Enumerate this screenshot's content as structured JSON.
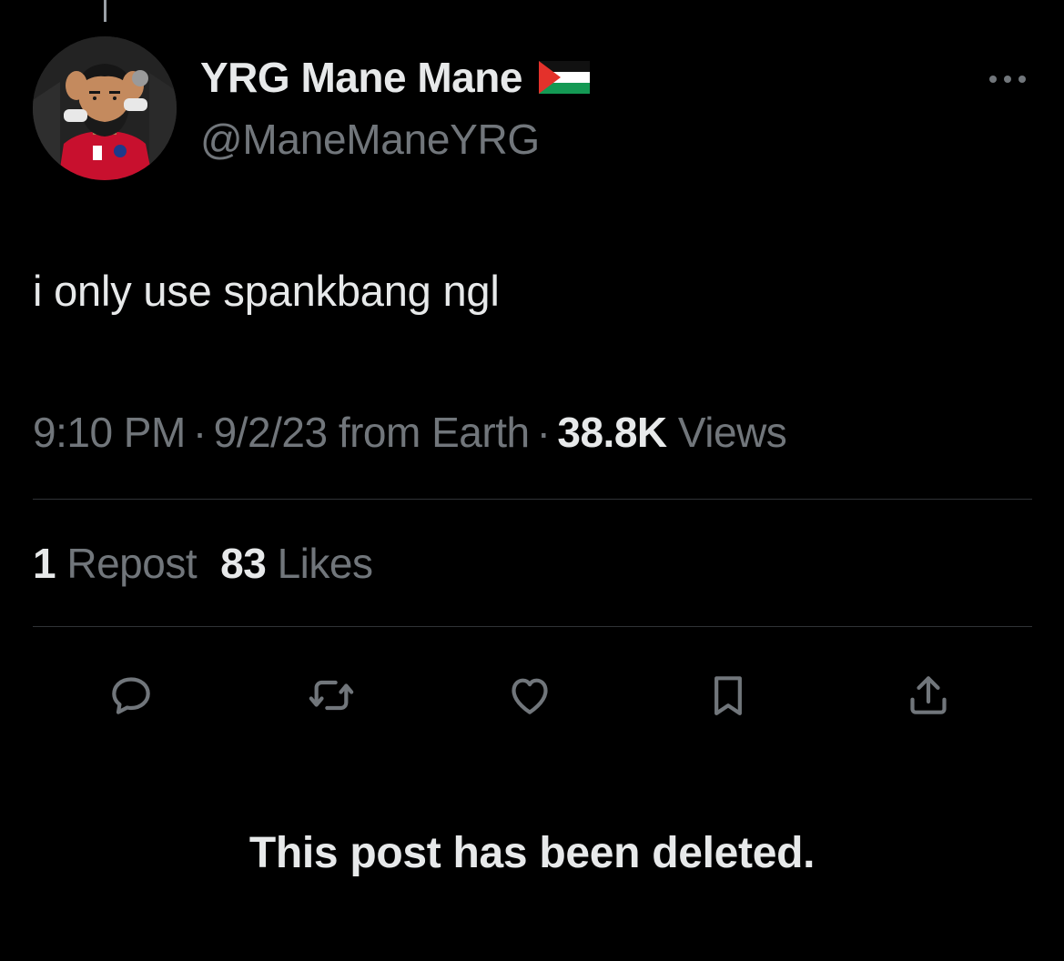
{
  "author": {
    "display_name": "YRG Mane Mane",
    "handle": "@ManeManeYRG",
    "avatar_icon": "cartoon-avatar-red-jersey",
    "flag_icon": "palestine-flag-icon"
  },
  "tweet": {
    "text": "i only use spankbang ngl"
  },
  "meta": {
    "time": "9:10 PM",
    "separator": "·",
    "date": "9/2/23",
    "source": "from Earth",
    "views_count": "38.8K",
    "views_label": "Views"
  },
  "stats": {
    "reposts_count": "1",
    "reposts_label": "Repost",
    "likes_count": "83",
    "likes_label": "Likes"
  },
  "actions": {
    "icons": [
      "reply-icon",
      "repost-icon",
      "like-icon",
      "bookmark-icon",
      "share-icon"
    ]
  },
  "notice": {
    "text": "This post has been deleted."
  },
  "colors": {
    "background": "#000000",
    "primary_text": "#e7e9ea",
    "secondary_text": "#71767b",
    "divider": "#2f3336"
  }
}
